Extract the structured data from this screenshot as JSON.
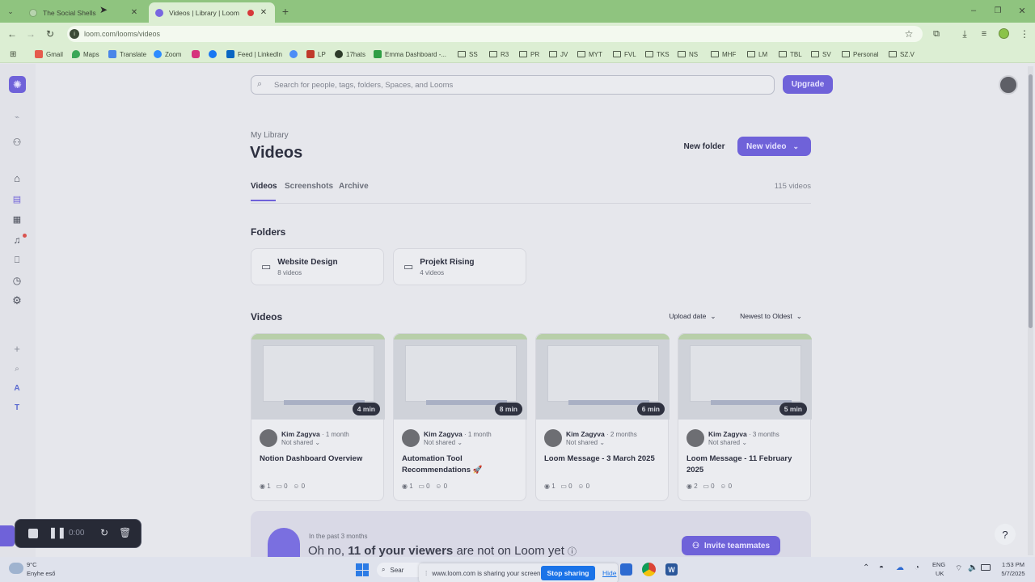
{
  "browser": {
    "tabs": [
      {
        "title": "The Social Shells",
        "active": false
      },
      {
        "title": "Videos | Library | Loom",
        "active": true
      }
    ],
    "url": "loom.com/looms/videos",
    "bookmarks": [
      "Gmail",
      "Maps",
      "Translate",
      "Zoom",
      "",
      "",
      "Feed | LinkedIn",
      "",
      "LP",
      "17hats",
      "Emma Dashboard -..."
    ],
    "bookmark_folders": [
      "SS",
      "R3",
      "PR",
      "JV",
      "MYT",
      "FVL",
      "TKS",
      "NS",
      "MHF",
      "LM",
      "TBL",
      "SV",
      "Personal",
      "SZ.V"
    ]
  },
  "app": {
    "search_placeholder": "Search for people, tags, folders, Spaces, and Looms",
    "upgrade": "Upgrade",
    "breadcrumb": "My Library",
    "title": "Videos",
    "new_folder": "New folder",
    "new_video": "New video",
    "tabs": [
      "Videos",
      "Screenshots",
      "Archive"
    ],
    "video_count": "115 videos",
    "folders_heading": "Folders",
    "folders": [
      {
        "name": "Website Design",
        "count": "8 videos"
      },
      {
        "name": "Projekt Rising",
        "count": "4 videos"
      }
    ],
    "videos_heading": "Videos",
    "sort_by": "Upload date",
    "order": "Newest to Oldest",
    "videos": [
      {
        "author": "Kim Zagyva",
        "age": "1 month",
        "share": "Not shared",
        "title": "Notion Dashboard Overview",
        "duration": "4 min",
        "views": "1",
        "comments": "0",
        "reactions": "0"
      },
      {
        "author": "Kim Zagyva",
        "age": "1 month",
        "share": "Not shared",
        "title": "Automation Tool Recommendations 🚀",
        "duration": "8 min",
        "views": "1",
        "comments": "0",
        "reactions": "0"
      },
      {
        "author": "Kim Zagyva",
        "age": "2 months",
        "share": "Not shared",
        "title": "Loom Message - 3 March 2025",
        "duration": "6 min",
        "views": "1",
        "comments": "0",
        "reactions": "0"
      },
      {
        "author": "Kim Zagyva",
        "age": "3 months",
        "share": "Not shared",
        "title": "Loom Message - 11 February 2025",
        "duration": "5 min",
        "views": "2",
        "comments": "0",
        "reactions": "0"
      }
    ],
    "banner": {
      "kicker": "In the past 3 months",
      "pre": "Oh no,",
      "strong": "11 of your viewers",
      "post": "are not on Loom yet",
      "invite": "Invite teammates"
    },
    "sidebar_letters": [
      "A",
      "T"
    ],
    "help": "?"
  },
  "recorder": {
    "time": "0:00"
  },
  "taskbar": {
    "weather_temp": "9°C",
    "weather_desc": "Enyhe eső",
    "search": "Sear",
    "share_text": "www.loom.com is sharing your screen.",
    "stop_sharing": "Stop sharing",
    "hide": "Hide",
    "lang": "ENG",
    "region": "UK",
    "time": "1:53 PM",
    "date": "5/7/2025"
  },
  "colors": {
    "accent": "#6f62d9",
    "tabbar": "#8fc47f",
    "toolbar": "#dceed3",
    "share_button": "#1a73e8"
  }
}
